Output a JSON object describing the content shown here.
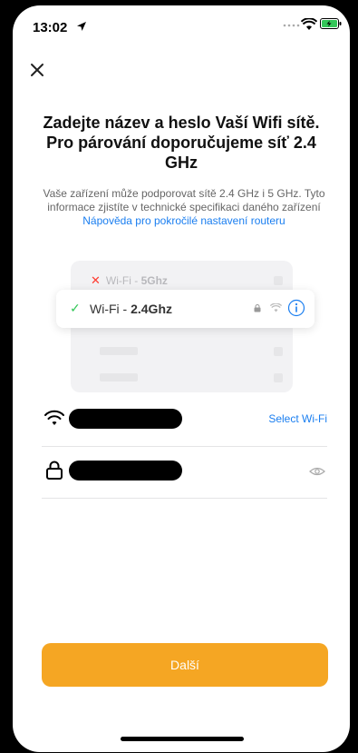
{
  "status_bar": {
    "time": "13:02"
  },
  "title": "Zadejte název a heslo Vaší Wifi sítě. Pro párování doporučujeme síť 2.4 GHz",
  "description": {
    "text": "Vaše zařízení může podporovat sítě 2.4 GHz i 5 GHz. Tyto informace zjistíte v technické specifikaci daného zařízení ",
    "link": "Nápověda pro pokročilé nastavení routeru"
  },
  "illustration": {
    "wifi_5": {
      "prefix": "Wi-Fi - ",
      "band": "5Ghz"
    },
    "wifi_24": {
      "prefix": "Wi-Fi - ",
      "band": "2.4Ghz"
    }
  },
  "wifi_field": {
    "select_label": "Select Wi-Fi"
  },
  "next_button": {
    "label": "Další"
  },
  "colors": {
    "accent": "#f5a623",
    "link": "#1a7ef0",
    "ok": "#34c759",
    "error": "#ff3b30"
  }
}
